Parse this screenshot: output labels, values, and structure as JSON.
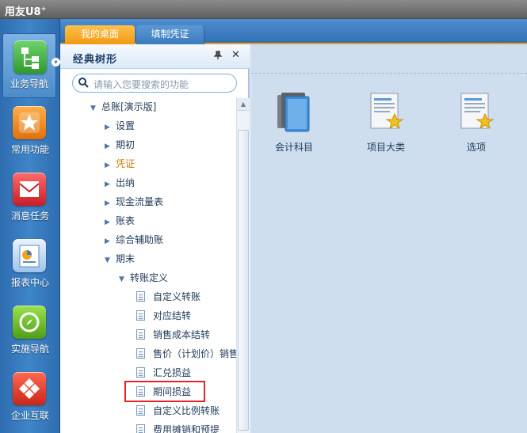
{
  "app": {
    "logo": "用友U8",
    "logo_sup": "+"
  },
  "nav": {
    "items": [
      {
        "label": "业务导航",
        "icon": "business-nav-icon",
        "color": "#3cae3c",
        "active": true
      },
      {
        "label": "常用功能",
        "icon": "star-icon",
        "color": "#f08a1c",
        "active": false
      },
      {
        "label": "消息任务",
        "icon": "envelope-icon",
        "color": "#e0303a",
        "active": false
      },
      {
        "label": "报表中心",
        "icon": "report-icon",
        "color": "#5aa0e0",
        "active": false
      },
      {
        "label": "实施导航",
        "icon": "compass-icon",
        "color": "#6fbf2a",
        "active": false
      },
      {
        "label": "企业互联",
        "icon": "network-icon",
        "color": "#e04030",
        "active": false
      }
    ]
  },
  "tabs": [
    {
      "label": "我的桌面",
      "active": true
    },
    {
      "label": "填制凭证",
      "active": false
    }
  ],
  "tree_panel": {
    "title": "经典树形",
    "search_placeholder": "请输入您要搜索的功能",
    "nodes": [
      {
        "label": "总账[演示版]",
        "level": 0,
        "expanded": true
      },
      {
        "label": "设置",
        "level": 1,
        "expanded": false
      },
      {
        "label": "期初",
        "level": 1,
        "expanded": false
      },
      {
        "label": "凭证",
        "level": 1,
        "expanded": false,
        "highlighted_color": "#d0790a"
      },
      {
        "label": "出纳",
        "level": 1,
        "expanded": false
      },
      {
        "label": "现金流量表",
        "level": 1,
        "expanded": false
      },
      {
        "label": "账表",
        "level": 1,
        "expanded": false
      },
      {
        "label": "综合辅助账",
        "level": 1,
        "expanded": false
      },
      {
        "label": "期末",
        "level": 1,
        "expanded": true
      },
      {
        "label": "转账定义",
        "level": 2,
        "expanded": true
      },
      {
        "label": "自定义转账",
        "level": 3,
        "leaf": true
      },
      {
        "label": "对应结转",
        "level": 3,
        "leaf": true
      },
      {
        "label": "销售成本结转",
        "level": 3,
        "leaf": true
      },
      {
        "label": "售价（计划价）销售",
        "level": 3,
        "leaf": true
      },
      {
        "label": "汇兑损益",
        "level": 3,
        "leaf": true
      },
      {
        "label": "期间损益",
        "level": 3,
        "leaf": true,
        "marked": true
      },
      {
        "label": "自定义比例转账",
        "level": 3,
        "leaf": true
      },
      {
        "label": "费用摊销和预提",
        "level": 3,
        "leaf": true
      }
    ]
  },
  "desktop": {
    "tiles": [
      {
        "label": "会计科目",
        "icon": "books-icon"
      },
      {
        "label": "项目大类",
        "icon": "doc-star-icon"
      },
      {
        "label": "选项",
        "icon": "doc-star-icon"
      }
    ]
  }
}
